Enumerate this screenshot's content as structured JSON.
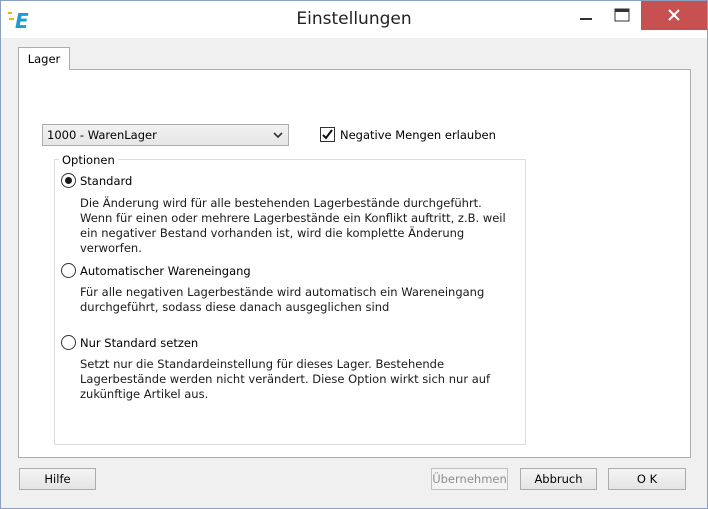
{
  "window": {
    "title": "Einstellungen",
    "close_color": "#c75050"
  },
  "tabs": [
    {
      "label": "Lager",
      "active": true
    }
  ],
  "warehouse_select": {
    "value": "1000 - WarenLager"
  },
  "negative_quantities": {
    "label": "Negative Mengen erlauben",
    "checked": true
  },
  "options_group": {
    "label": "Optionen",
    "options": [
      {
        "label": "Standard",
        "selected": true,
        "description": "Die Änderung wird für alle bestehenden Lagerbestände durchgeführt. Wenn für einen oder mehrere Lagerbestände ein Konflikt auftritt, z.B. weil ein negativer Bestand vorhanden ist, wird die komplette Änderung verworfen."
      },
      {
        "label": "Automatischer Wareneingang",
        "selected": false,
        "description": "Für alle negativen Lagerbestände wird automatisch ein Wareneingang durchgeführt, sodass diese danach ausgeglichen sind"
      },
      {
        "label": "Nur Standard setzen",
        "selected": false,
        "description": "Setzt nur die Standardeinstellung für dieses Lager. Bestehende Lagerbestände werden nicht verändert. Diese Option wirkt sich nur auf zukünftige Artikel aus."
      }
    ]
  },
  "buttons": {
    "help": "Hilfe",
    "apply": "Übernehmen",
    "cancel": "Abbruch",
    "ok": "O K"
  }
}
